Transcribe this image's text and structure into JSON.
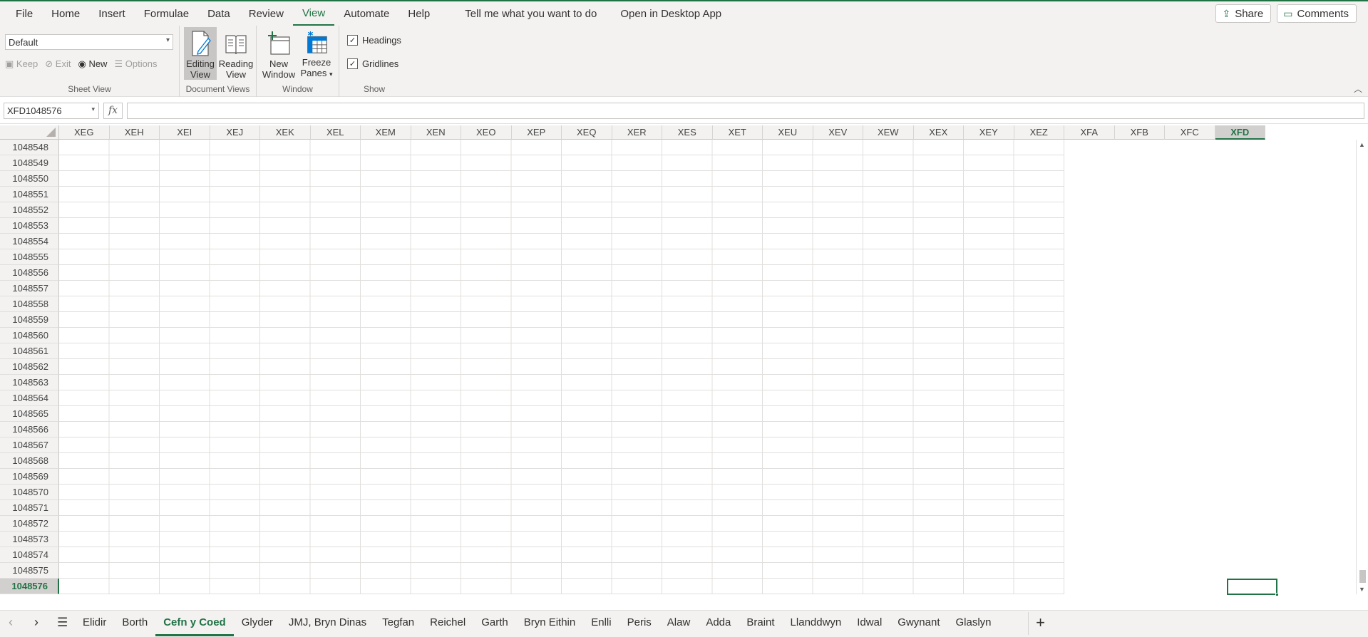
{
  "menubar": {
    "items": [
      "File",
      "Home",
      "Insert",
      "Formulae",
      "Data",
      "Review",
      "View",
      "Automate",
      "Help"
    ],
    "active": "View",
    "tell_me": "Tell me what you want to do",
    "open_desktop": "Open in Desktop App",
    "share": "Share",
    "comments": "Comments"
  },
  "ribbon": {
    "sheet_view": {
      "select_value": "Default",
      "keep": "Keep",
      "exit": "Exit",
      "new": "New",
      "options": "Options",
      "label": "Sheet View"
    },
    "document_views": {
      "editing": [
        "Editing",
        "View"
      ],
      "reading": [
        "Reading",
        "View"
      ],
      "label": "Document Views"
    },
    "window": {
      "new_window": [
        "New",
        "Window"
      ],
      "freeze": [
        "Freeze",
        "Panes"
      ],
      "label": "Window"
    },
    "show": {
      "headings": "Headings",
      "gridlines": "Gridlines",
      "headings_checked": true,
      "gridlines_checked": true,
      "label": "Show"
    }
  },
  "formula_bar": {
    "name_box": "XFD1048576",
    "fx": "fx",
    "formula": ""
  },
  "grid": {
    "columns": [
      "XEG",
      "XEH",
      "XEI",
      "XEJ",
      "XEK",
      "XEL",
      "XEM",
      "XEN",
      "XEO",
      "XEP",
      "XEQ",
      "XER",
      "XES",
      "XET",
      "XEU",
      "XEV",
      "XEW",
      "XEX",
      "XEY",
      "XEZ",
      "XFA",
      "XFB",
      "XFC",
      "XFD"
    ],
    "selected_column": "XFD",
    "rows": [
      "1048548",
      "1048549",
      "1048550",
      "1048551",
      "1048552",
      "1048553",
      "1048554",
      "1048555",
      "1048556",
      "1048557",
      "1048558",
      "1048559",
      "1048560",
      "1048561",
      "1048562",
      "1048563",
      "1048564",
      "1048565",
      "1048566",
      "1048567",
      "1048568",
      "1048569",
      "1048570",
      "1048571",
      "1048572",
      "1048573",
      "1048574",
      "1048575",
      "1048576"
    ],
    "selected_row": "1048576"
  },
  "sheets": {
    "tabs": [
      "Elidir",
      "Borth",
      "Cefn y Coed",
      "Glyder",
      "JMJ, Bryn Dinas",
      "Tegfan",
      "Reichel",
      "Garth",
      "Bryn Eithin",
      "Enlli",
      "Peris",
      "Alaw",
      "Adda",
      "Braint",
      "Llanddwyn",
      "Idwal",
      "Gwynant",
      "Glaslyn"
    ],
    "active": "Cefn y Coed"
  },
  "colors": {
    "accent": "#217346",
    "ribbon_bg": "#f3f2f1",
    "gridline": "#e1dfdd"
  }
}
